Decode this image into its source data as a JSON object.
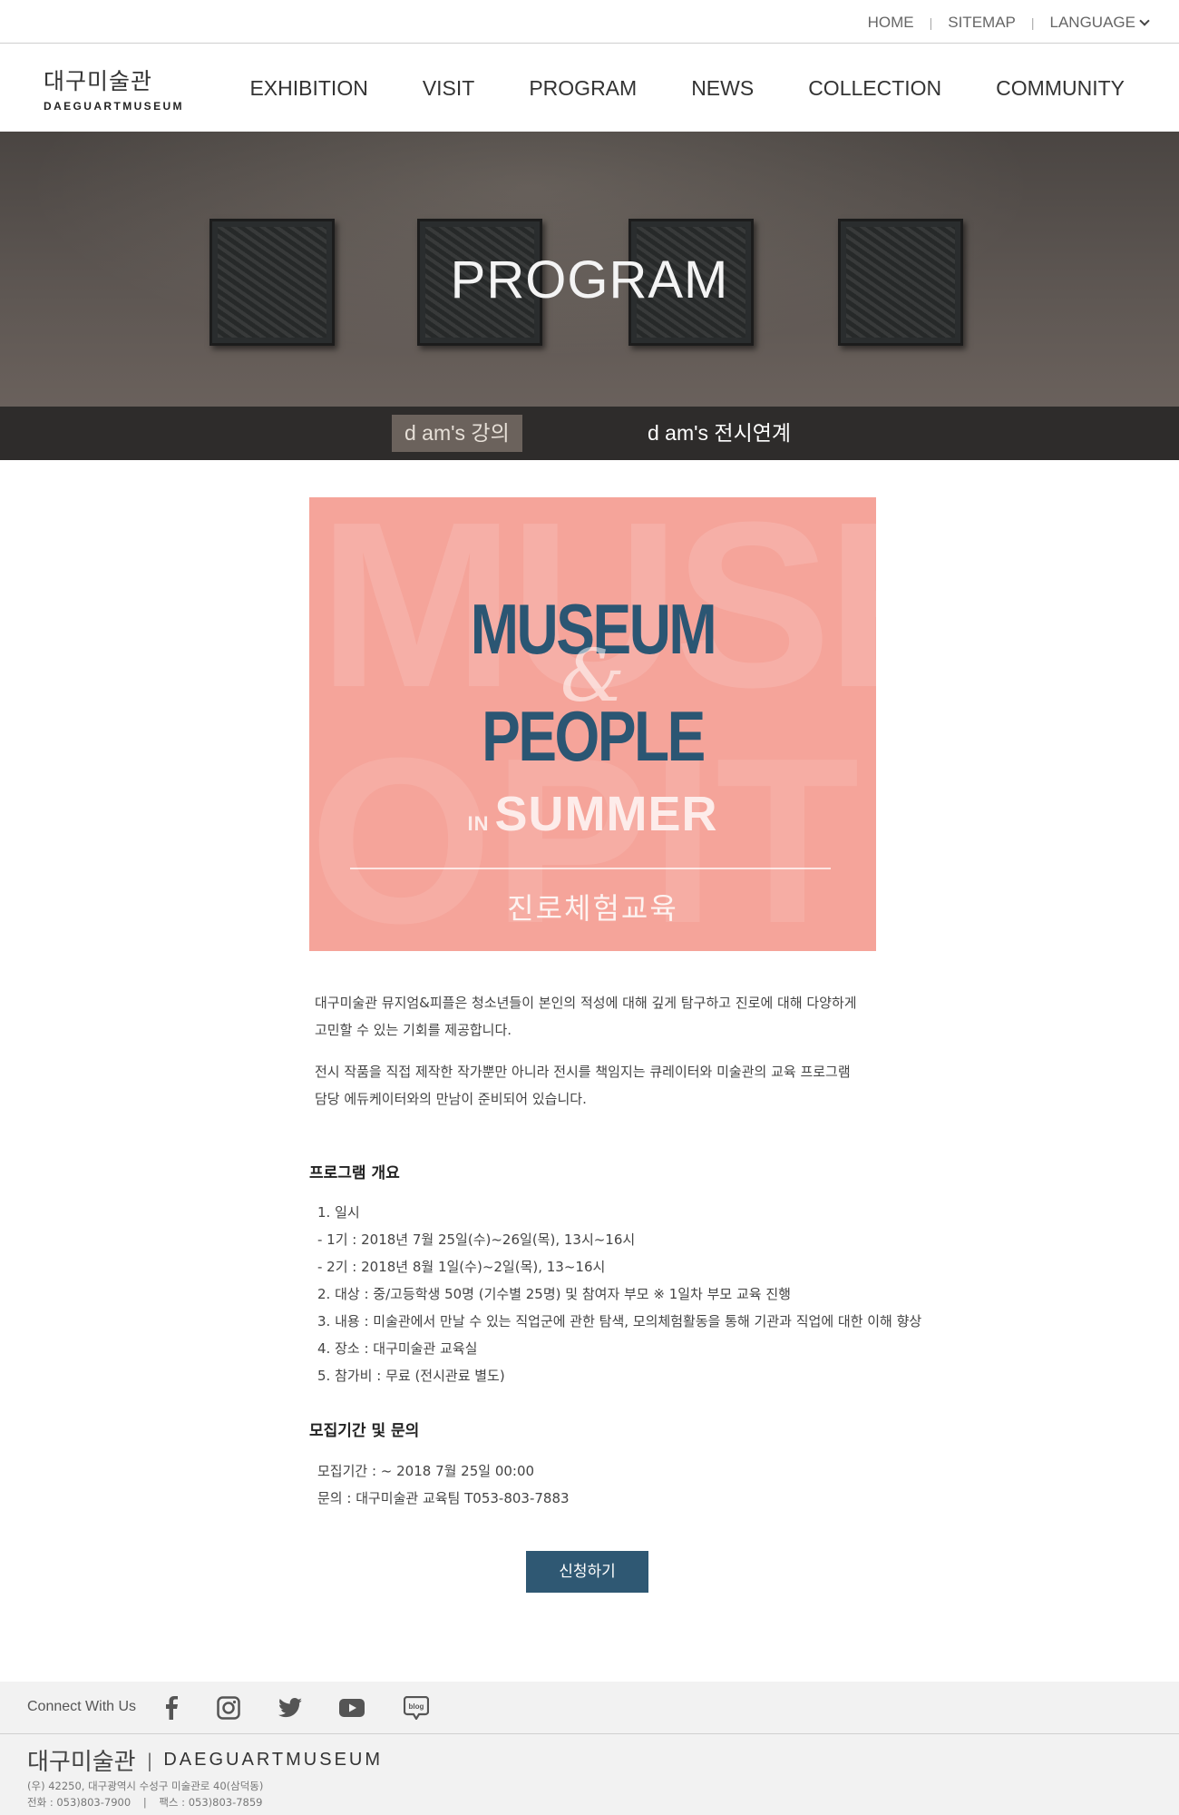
{
  "util": {
    "home": "HOME",
    "sitemap": "SITEMAP",
    "language": "LANGUAGE"
  },
  "logo": {
    "ko": "대구미술관",
    "en": "DAEGUARTMUSEUM"
  },
  "nav": [
    "EXHIBITION",
    "VISIT",
    "PROGRAM",
    "NEWS",
    "COLLECTION",
    "COMMUNITY"
  ],
  "hero": {
    "title": "PROGRAM"
  },
  "subnav": {
    "tab1": "d am's 강의",
    "tab2": "d am's 전시연계",
    "active": "tab1"
  },
  "poster": {
    "bg_text_1": "MUSEU",
    "bg_text_2": "OPIT",
    "line1": "MUSEUM",
    "amp": "&",
    "line2": "PEOPLE",
    "in": "IN",
    "summer": "SUMMER",
    "subtitle": "진로체험교육"
  },
  "intro": {
    "p1a": "대구미술관 뮤지엄&피플은 청소년들이 본인의 적성에 대해 깊게 탐구하고 진로에 대해 다양하게",
    "p1b": "고민할 수 있는 기회를 제공합니다.",
    "p2a": "전시 작품을 직접 제작한 작가뿐만 아니라 전시를 책임지는 큐레이터와 미술관의 교육 프로그램",
    "p2b": "담당 에듀케이터와의 만남이 준비되어 있습니다."
  },
  "overview": {
    "heading": "프로그램 개요",
    "items": [
      "1. 일시",
      "- 1기 : 2018년 7월 25일(수)~26일(목), 13시~16시",
      "- 2기 : 2018년 8월 1일(수)~2일(목), 13~16시",
      "2. 대상 : 중/고등학생 50명 (기수별 25명) 및 참여자 부모 ※ 1일차 부모 교육 진행",
      "3. 내용 : 미술관에서 만날 수 있는 직업군에 관한 탐색, 모의체험활동을 통해 기관과 직업에 대한 이해 향상",
      "4. 장소 : 대구미술관 교육실",
      "5. 참가비 : 무료 (전시관료 별도)"
    ]
  },
  "recruit": {
    "heading": "모집기간 및 문의",
    "items": [
      "모집기간 : ~ 2018 7월 25일 00:00",
      "문의 : 대구미술관 교육팀 T053-803-7883"
    ]
  },
  "apply_label": "신청하기",
  "footer": {
    "connect": "Connect With Us",
    "social_icons": [
      "facebook-icon",
      "instagram-icon",
      "twitter-icon",
      "youtube-icon",
      "blog-icon"
    ],
    "blog_text": "blog",
    "logo_ko": "대구미술관",
    "logo_sep": "|",
    "logo_en": "DAEGUARTMUSEUM",
    "address": "(우) 42250, 대구광역시 수성구 미술관로 40(삼덕동)",
    "phone": "전화 : 053)803-7900",
    "phone_sep": "|",
    "fax": "팩스 : 053)803-7859"
  },
  "colors": {
    "accent_blue": "#2f5873",
    "poster_bg": "#f5a49a",
    "subnav_bg": "#2e2c2b",
    "active_tab": "#6b625c"
  }
}
